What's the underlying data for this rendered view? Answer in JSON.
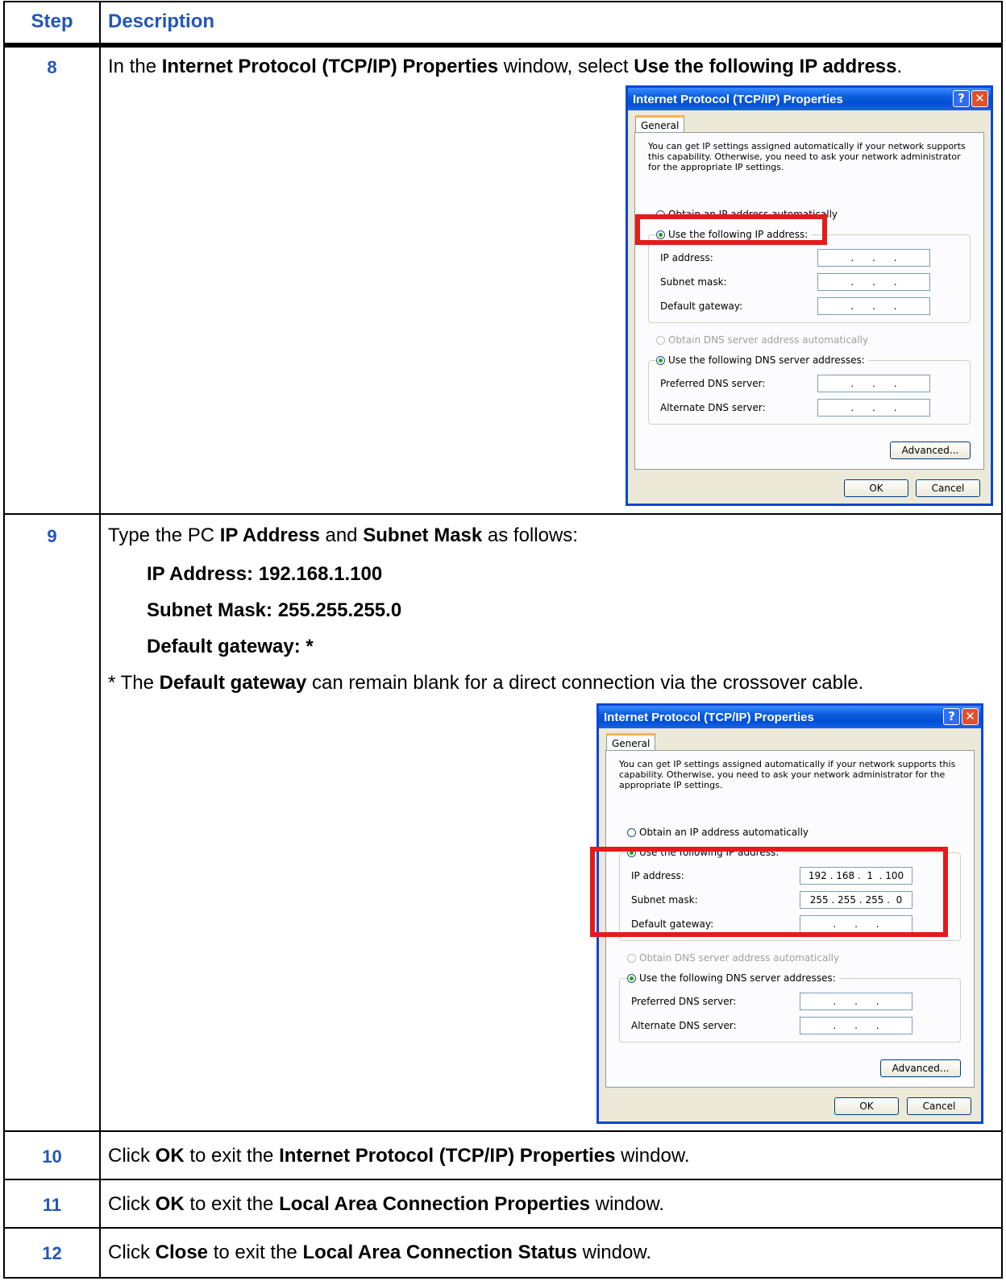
{
  "header": {
    "step": "Step",
    "description": "Description"
  },
  "step8": {
    "num": "8",
    "t1": "In the ",
    "b1": "Internet Protocol (TCP/IP) Properties",
    "t2": " window, select ",
    "b2": "Use the following IP address",
    "t3": "."
  },
  "step9": {
    "num": "9",
    "t1": "Type the PC ",
    "b1": "IP Address",
    "t2": " and ",
    "b2": "Subnet Mask",
    "t3": " as follows:",
    "ip_line": "IP Address: 192.168.1.100",
    "mask_line": "Subnet Mask: 255.255.255.0",
    "gw_line": "Default gateway: *",
    "note1": "* The ",
    "note_b": "Default gateway",
    "note2": " can remain blank for a direct connection via the crossover cable."
  },
  "step10": {
    "num": "10",
    "t1": "Click ",
    "b1": "OK",
    "t2": " to exit the ",
    "b2": "Internet Protocol (TCP/IP) Properties",
    "t3": " window."
  },
  "step11": {
    "num": "11",
    "t1": "Click ",
    "b1": "OK",
    "t2": " to exit the ",
    "b2": "Local Area Connection Properties",
    "t3": " window."
  },
  "step12": {
    "num": "12",
    "t1": "Click ",
    "b1": "Close",
    "t2": " to exit the ",
    "b2": "Local Area Connection Status",
    "t3": " window."
  },
  "dialog": {
    "title": "Internet Protocol (TCP/IP) Properties",
    "help": "?",
    "close": "✕",
    "tab": "General",
    "intro": "You can get IP settings assigned automatically if your network supports this capability. Otherwise, you need to ask your network administrator for the appropriate IP settings.",
    "obtain_ip": "Obtain an IP address automatically",
    "use_ip": "Use the following IP address:",
    "ip_label": "IP address:",
    "mask_label": "Subnet mask:",
    "gw_label": "Default gateway:",
    "obtain_dns": "Obtain DNS server address automatically",
    "use_dns": "Use the following DNS server addresses:",
    "pref_dns": "Preferred DNS server:",
    "alt_dns": "Alternate DNS server:",
    "advanced": "Advanced...",
    "ok": "OK",
    "cancel": "Cancel",
    "empty_ip": "  .      .      .  "
  },
  "dialog2_values": {
    "ip": "192 . 168 .  1  . 100",
    "mask": "255 . 255 . 255 .  0"
  }
}
